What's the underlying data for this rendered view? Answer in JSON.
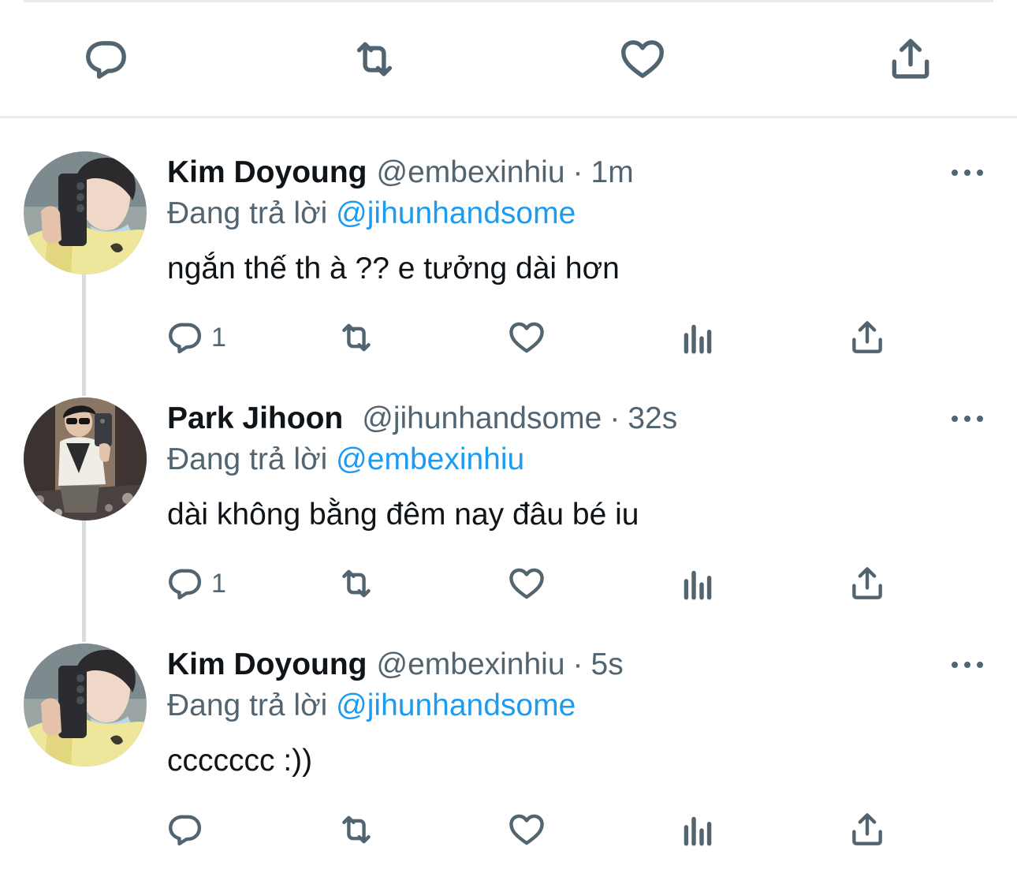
{
  "colors": {
    "text": "#0f1419",
    "secondary": "#536471",
    "mention": "#1d9bf0",
    "divider": "#e8eaec",
    "thread_line": "#d9dde0"
  },
  "main_tweet_actions": [
    {
      "name": "reply-button",
      "icon": "reply-icon"
    },
    {
      "name": "retweet-button",
      "icon": "retweet-icon"
    },
    {
      "name": "like-button",
      "icon": "heart-icon"
    },
    {
      "name": "share-button",
      "icon": "share-icon"
    }
  ],
  "replies": [
    {
      "display_name": "Kim Doyoung",
      "handle": "@embexinhiu",
      "separator": "·",
      "time": "1m",
      "replying_prefix": "Đang trả lời",
      "replying_to": "@jihunhandsome",
      "text": "ngắn thế th à ?? e tưởng dài hơn",
      "reply_count": "1",
      "avatar": "profile-photo-selfie-yellow-sweater"
    },
    {
      "display_name": "Park Jihoon",
      "handle": "@jihunhandsome",
      "separator": "·",
      "time": "32s",
      "replying_prefix": "Đang trả lời",
      "replying_to": "@embexinhiu",
      "text": "dài không bằng đêm nay đâu bé iu",
      "reply_count": "1",
      "avatar": "profile-photo-mirror-selfie"
    },
    {
      "display_name": "Kim Doyoung",
      "handle": "@embexinhiu",
      "separator": "·",
      "time": "5s",
      "replying_prefix": "Đang trả lời",
      "replying_to": "@jihunhandsome",
      "text": "ccccccc :))",
      "reply_count": "",
      "avatar": "profile-photo-selfie-yellow-sweater"
    }
  ],
  "reply_action_icons": [
    "reply-icon",
    "retweet-icon",
    "heart-icon",
    "analytics-icon",
    "share-icon"
  ]
}
